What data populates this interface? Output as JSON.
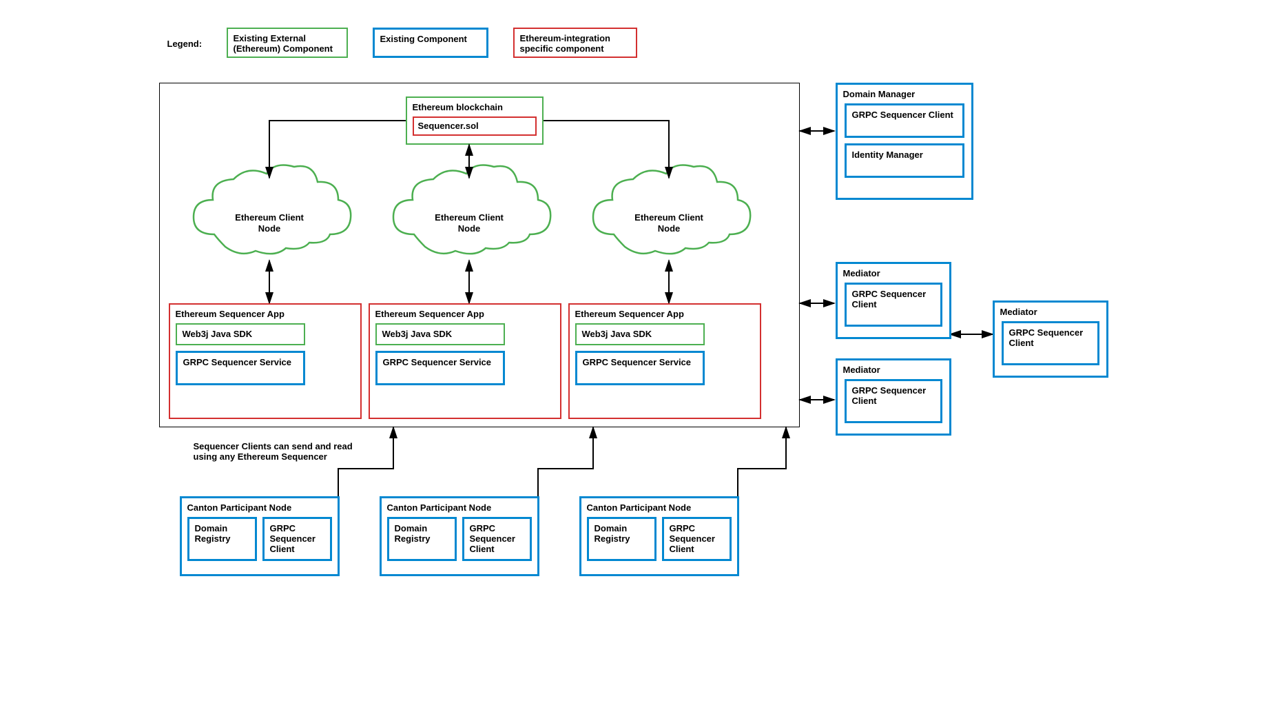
{
  "legend": {
    "label": "Legend:",
    "external": "Existing External (Ethereum) Component",
    "existing": "Existing Component",
    "eth_specific": "Ethereum-integration specific component"
  },
  "blockchain": {
    "title": "Ethereum blockchain",
    "contract": "Sequencer.sol"
  },
  "client_node": "Ethereum Client Node",
  "sequencer_app": {
    "title": "Ethereum Sequencer App",
    "web3j": "Web3j Java SDK",
    "grpc_service": "GRPC Sequencer Service"
  },
  "note": "Sequencer Clients can send and read using any Ethereum Sequencer",
  "participant": {
    "title": "Canton Participant Node",
    "domain_registry": "Domain Registry",
    "grpc_client": "GRPC Sequencer Client"
  },
  "domain_manager": {
    "title": "Domain Manager",
    "grpc_client": "GRPC Sequencer Client",
    "identity": "Identity Manager"
  },
  "mediator": {
    "title": "Mediator",
    "grpc_client": "GRPC Sequencer Client"
  }
}
